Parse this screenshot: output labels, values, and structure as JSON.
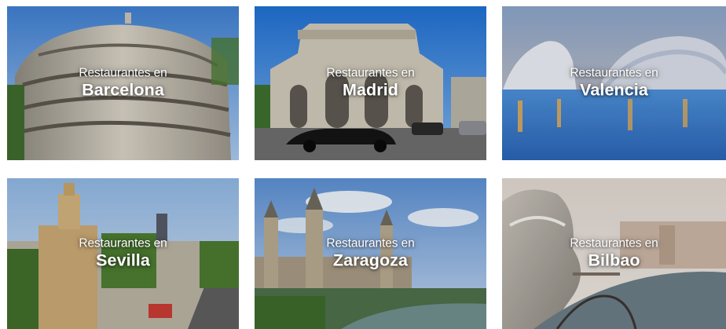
{
  "cards": [
    {
      "prefix": "Restaurantes en",
      "city": "Barcelona"
    },
    {
      "prefix": "Restaurantes en",
      "city": "Madrid"
    },
    {
      "prefix": "Restaurantes en",
      "city": "Valencia"
    },
    {
      "prefix": "Restaurantes en",
      "city": "Sevilla"
    },
    {
      "prefix": "Restaurantes en",
      "city": "Zaragoza"
    },
    {
      "prefix": "Restaurantes en",
      "city": "Bilbao"
    }
  ]
}
